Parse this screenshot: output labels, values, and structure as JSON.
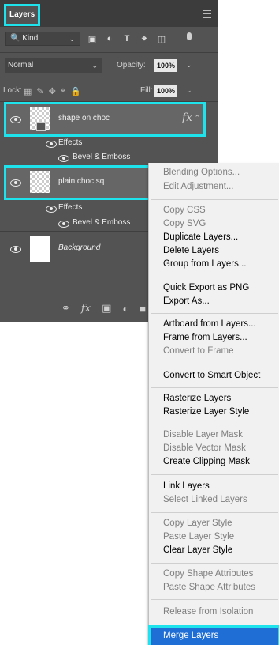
{
  "panel": {
    "tab_title": "Layers",
    "kind_label": "Kind",
    "blend_mode": "Normal",
    "opacity_label": "Opacity:",
    "opacity_value": "100%",
    "lock_label": "Lock:",
    "fill_label": "Fill:",
    "fill_value": "100%",
    "fx_label": "fx"
  },
  "layers": [
    {
      "name": "shape on choc",
      "effects_label": "Effects",
      "effect": "Bevel & Emboss"
    },
    {
      "name": "plain choc sq",
      "effects_label": "Effects",
      "effect": "Bevel & Emboss"
    },
    {
      "name": "Background"
    }
  ],
  "menu": {
    "items": [
      "Blending Options...",
      "Edit Adjustment...",
      "Copy CSS",
      "Copy SVG",
      "Duplicate Layers...",
      "Delete Layers",
      "Group from Layers...",
      "Quick Export as PNG",
      "Export As...",
      "Artboard from Layers...",
      "Frame from Layers...",
      "Convert to Frame",
      "Convert to Smart Object",
      "Rasterize Layers",
      "Rasterize Layer Style",
      "Disable Layer Mask",
      "Disable Vector Mask",
      "Create Clipping Mask",
      "Link Layers",
      "Select Linked Layers",
      "Copy Layer Style",
      "Paste Layer Style",
      "Clear Layer Style",
      "Copy Shape Attributes",
      "Paste Shape Attributes",
      "Release from Isolation",
      "Merge Layers"
    ]
  },
  "colors": {
    "panel_bg": "#535353",
    "highlight": "#1fe3ec",
    "menu_bg": "#f1f1f1",
    "selection": "#1e6ed6"
  }
}
